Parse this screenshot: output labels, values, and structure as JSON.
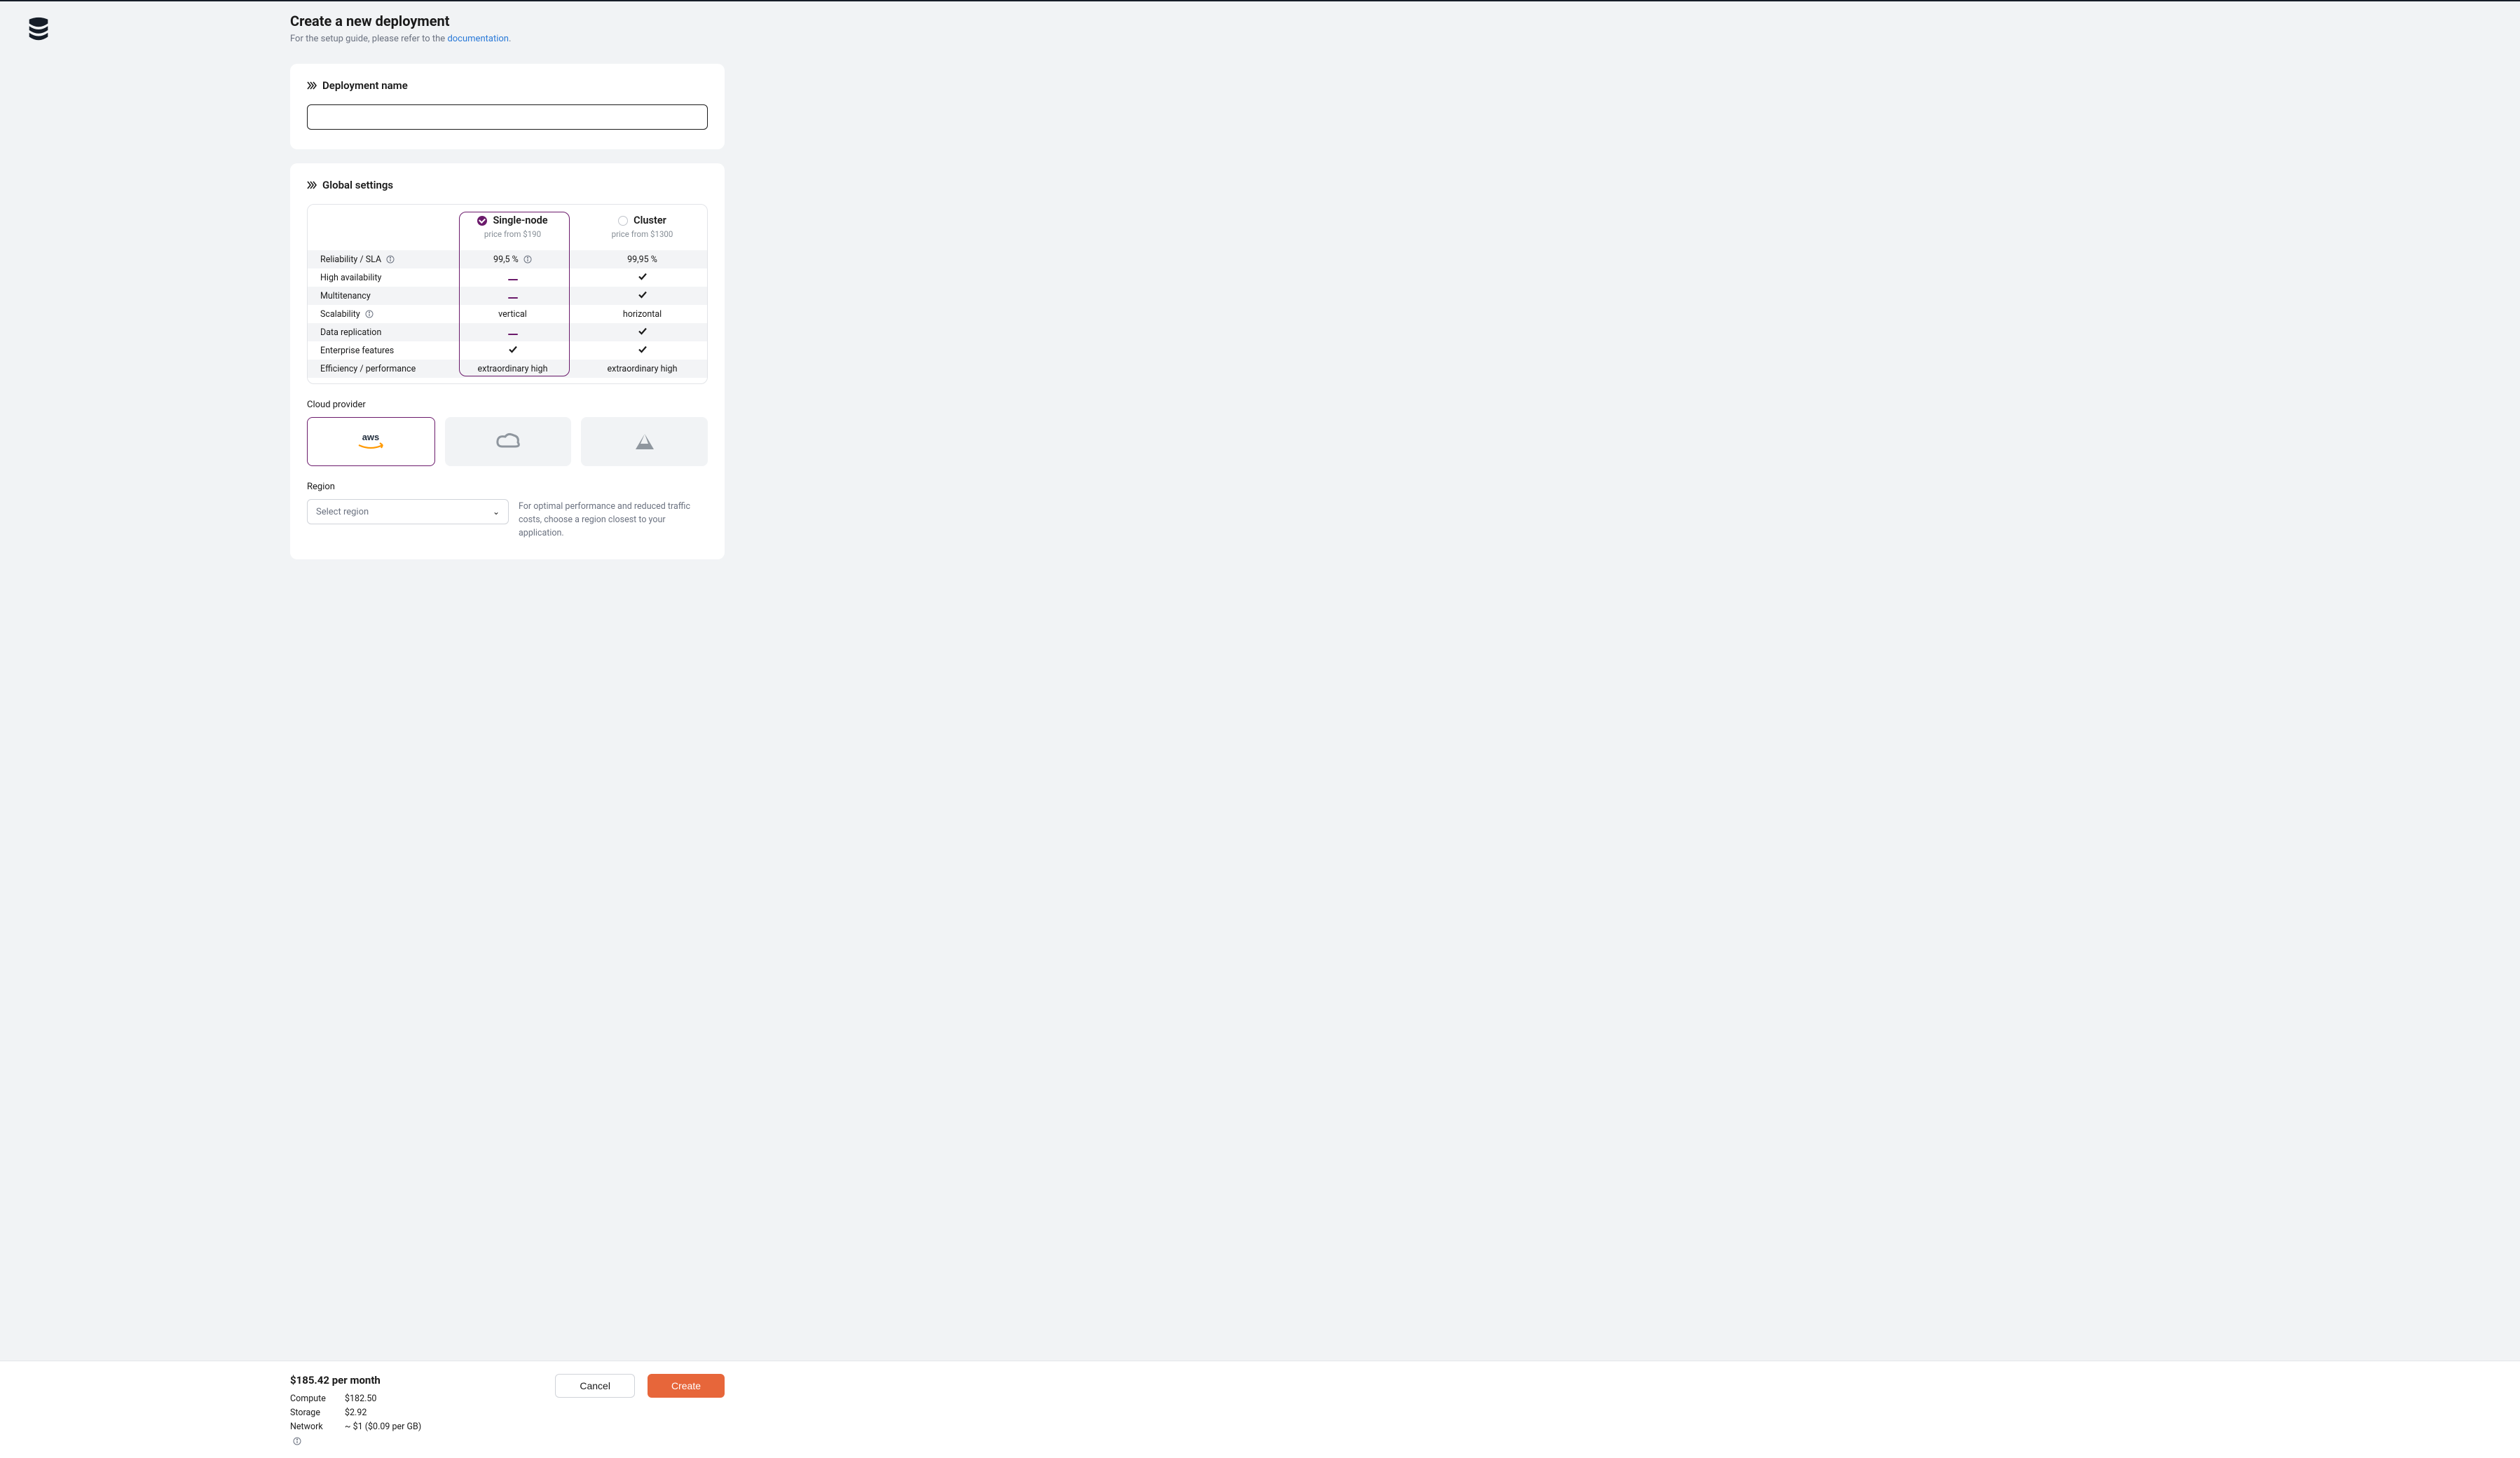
{
  "header": {
    "title": "Create a new deployment",
    "subtext_pre": "For the setup guide, please refer to the ",
    "subtext_link": "documentation",
    "subtext_post": "."
  },
  "sections": {
    "name_title": "Deployment name",
    "global_title": "Global settings",
    "cloud_label": "Cloud provider",
    "region_label": "Region",
    "region_placeholder": "Select region",
    "region_hint": "For optimal performance and reduced traffic costs, choose a region closest to your application."
  },
  "plans": {
    "single": {
      "label": "Single-node",
      "price": "price from $190"
    },
    "cluster": {
      "label": "Cluster",
      "price": "price from $1300"
    }
  },
  "features": [
    {
      "label": "Reliability / SLA",
      "info": true,
      "single": "99,5 %",
      "single_info": true,
      "cluster": "99,95 %"
    },
    {
      "label": "High availability",
      "single": "dash",
      "cluster": "check"
    },
    {
      "label": "Multitenancy",
      "single": "dash",
      "cluster": "check"
    },
    {
      "label": "Scalability",
      "info": true,
      "single": "vertical",
      "cluster": "horizontal"
    },
    {
      "label": "Data replication",
      "single": "dash",
      "cluster": "check"
    },
    {
      "label": "Enterprise features",
      "single": "check",
      "cluster": "check"
    },
    {
      "label": "Efficiency / performance",
      "single": "extraordinary high",
      "cluster": "extraordinary high"
    }
  ],
  "providers": [
    "aws",
    "gcp",
    "azure"
  ],
  "footer": {
    "price": "$185.42 per month",
    "lines": [
      {
        "k": "Compute",
        "v": "$182.50"
      },
      {
        "k": "Storage",
        "v": "$2.92"
      },
      {
        "k": "Network",
        "info": true,
        "v": "~ $1 ($0.09 per GB)"
      }
    ],
    "cancel": "Cancel",
    "create": "Create"
  }
}
